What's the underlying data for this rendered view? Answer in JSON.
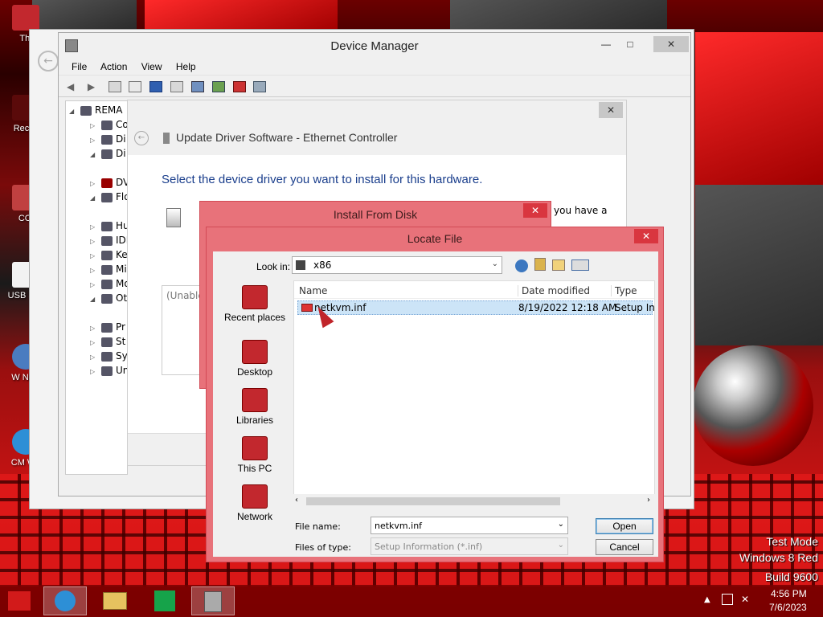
{
  "desktop": {
    "icons": [
      {
        "label": "Thi"
      },
      {
        "label": "Recyc"
      },
      {
        "label": "CCl"
      },
      {
        "label": "USB Sec"
      },
      {
        "label": "W Navi"
      },
      {
        "label": "CM We"
      }
    ],
    "watermark": {
      "line1": "Test Mode",
      "line2": "Windows 8 Red",
      "line3": "Build 9600"
    }
  },
  "device_manager": {
    "title": "Device Manager",
    "menu": [
      "File",
      "Action",
      "View",
      "Help"
    ],
    "tree": {
      "root": "REMA",
      "items": [
        "Co",
        "Di",
        "Di",
        "DV",
        "Flo",
        "Hu",
        "IDI",
        "Ke",
        "Mi",
        "Mo",
        "Ot",
        "Pr",
        "St",
        "Sy",
        "Un"
      ]
    }
  },
  "update_driver": {
    "title": "Update Driver Software - Ethernet Controller",
    "heading": "Select the device driver you want to install for this hardware.",
    "side_text": "you have a",
    "unable_text": "(Unable"
  },
  "install_disk": {
    "title": "Install From Disk"
  },
  "locate_file": {
    "title": "Locate File",
    "look_in_label": "Look in:",
    "look_in_value": "x86",
    "places": [
      "Recent places",
      "Desktop",
      "Libraries",
      "This PC",
      "Network"
    ],
    "columns": [
      "Name",
      "Date modified",
      "Type"
    ],
    "files": [
      {
        "name": "netkvm.inf",
        "date": "8/19/2022 12:18 AM",
        "type": "Setup Infc"
      }
    ],
    "file_name_label": "File name:",
    "file_name_value": "netkvm.inf",
    "files_type_label": "Files of type:",
    "files_type_value": "Setup Information (*.inf)",
    "open_label": "Open",
    "cancel_label": "Cancel"
  },
  "taskbar": {
    "time": "4:56 PM",
    "date": "7/6/2023"
  },
  "colors": {
    "accent": "#c2282e",
    "dialog_frame": "#e8727a",
    "selection": "#cce4f7"
  }
}
